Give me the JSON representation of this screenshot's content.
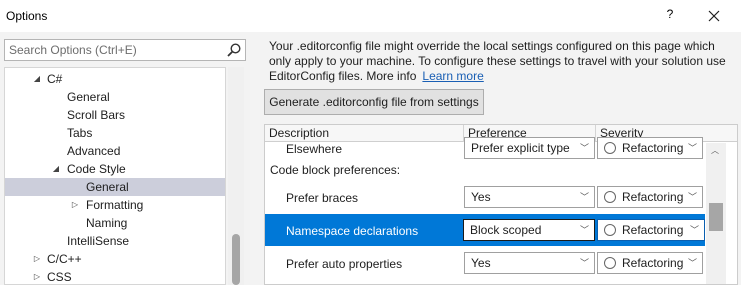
{
  "window": {
    "title": "Options",
    "help_label": "?"
  },
  "search": {
    "placeholder": "Search Options (Ctrl+E)"
  },
  "tree": {
    "items": [
      {
        "label": "C#",
        "arrow": "◢"
      },
      {
        "label": "General"
      },
      {
        "label": "Scroll Bars"
      },
      {
        "label": "Tabs"
      },
      {
        "label": "Advanced"
      },
      {
        "label": "Code Style",
        "arrow": "◢"
      },
      {
        "label": "General"
      },
      {
        "label": "Formatting",
        "arrow": "▷"
      },
      {
        "label": "Naming"
      },
      {
        "label": "IntelliSense"
      },
      {
        "label": "C/C++",
        "arrow": "▷"
      },
      {
        "label": "CSS",
        "arrow": "▷"
      }
    ]
  },
  "notice": {
    "text": "Your .editorconfig file might override the local settings configured on this page which only apply to your machine. To configure these settings to travel with your solution use EditorConfig files. More info",
    "link": "Learn more"
  },
  "generate_button": "Generate .editorconfig file from settings",
  "grid": {
    "columns": [
      "Description",
      "Preference",
      "Severity"
    ],
    "rows": [
      {
        "description": "Elsewhere",
        "preference": "Prefer explicit type",
        "severity": "Refactoring"
      },
      {
        "description": "Code block preferences:"
      },
      {
        "description": "Prefer braces",
        "preference": "Yes",
        "severity": "Refactoring"
      },
      {
        "description": "Namespace declarations",
        "preference": "Block scoped",
        "severity": "Refactoring"
      },
      {
        "description": "Prefer auto properties",
        "preference": "Yes",
        "severity": "Refactoring"
      }
    ]
  },
  "icons": {
    "search": "search-icon",
    "close": "close-icon",
    "dropdown": "chevron-down-icon",
    "severity": "radio-circle-icon"
  },
  "colors": {
    "selection": "#0078d7",
    "tree_selection": "#cccedb",
    "link": "#1a5fb4"
  }
}
